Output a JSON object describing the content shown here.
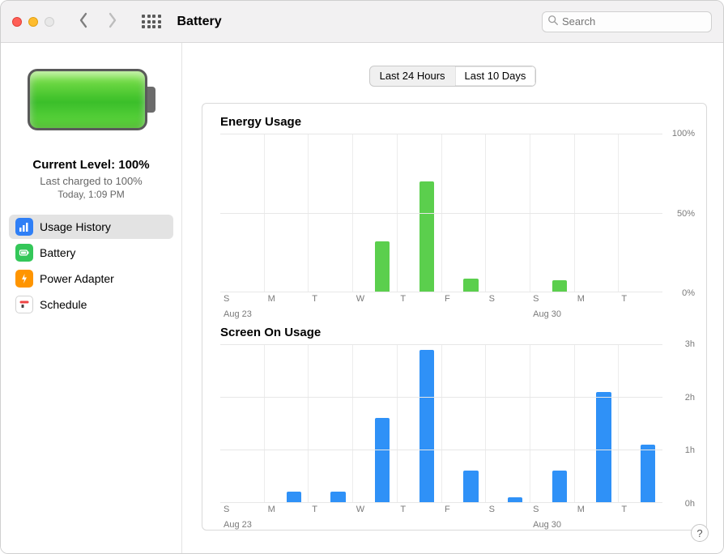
{
  "window": {
    "title": "Battery",
    "search_placeholder": "Search"
  },
  "sidebar": {
    "level_title": "Current Level: 100%",
    "level_sub": "Last charged to 100%",
    "level_time": "Today, 1:09 PM",
    "items": [
      {
        "label": "Usage History"
      },
      {
        "label": "Battery"
      },
      {
        "label": "Power Adapter"
      },
      {
        "label": "Schedule"
      }
    ]
  },
  "segmented": {
    "options": [
      "Last 24 Hours",
      "Last 10 Days"
    ],
    "selected": 1
  },
  "charts": {
    "energy_title": "Energy Usage",
    "screen_title": "Screen On Usage"
  },
  "help_label": "?",
  "chart_data": [
    {
      "type": "bar",
      "title": "Energy Usage",
      "xlabel": "",
      "ylabel": "",
      "ylim": [
        0,
        100
      ],
      "y_ticks": [
        "100%",
        "50%",
        "0%"
      ],
      "categories": [
        "S",
        "M",
        "T",
        "W",
        "T",
        "F",
        "S",
        "S",
        "M",
        "T"
      ],
      "date_sublabels": [
        "Aug 23",
        "",
        "",
        "",
        "",
        "",
        "",
        "Aug 30",
        "",
        ""
      ],
      "values": [
        0,
        0,
        0,
        32,
        70,
        8,
        0,
        7,
        0,
        0
      ]
    },
    {
      "type": "bar",
      "title": "Screen On Usage",
      "xlabel": "",
      "ylabel": "",
      "ylim": [
        0,
        3
      ],
      "y_ticks": [
        "3h",
        "2h",
        "1h",
        "0h"
      ],
      "categories": [
        "S",
        "M",
        "T",
        "W",
        "T",
        "F",
        "S",
        "S",
        "M",
        "T"
      ],
      "date_sublabels": [
        "Aug 23",
        "",
        "",
        "",
        "",
        "",
        "",
        "Aug 30",
        "",
        ""
      ],
      "values": [
        0,
        0.2,
        0.2,
        1.6,
        2.9,
        0.6,
        0.1,
        0.6,
        2.1,
        1.1
      ]
    }
  ]
}
